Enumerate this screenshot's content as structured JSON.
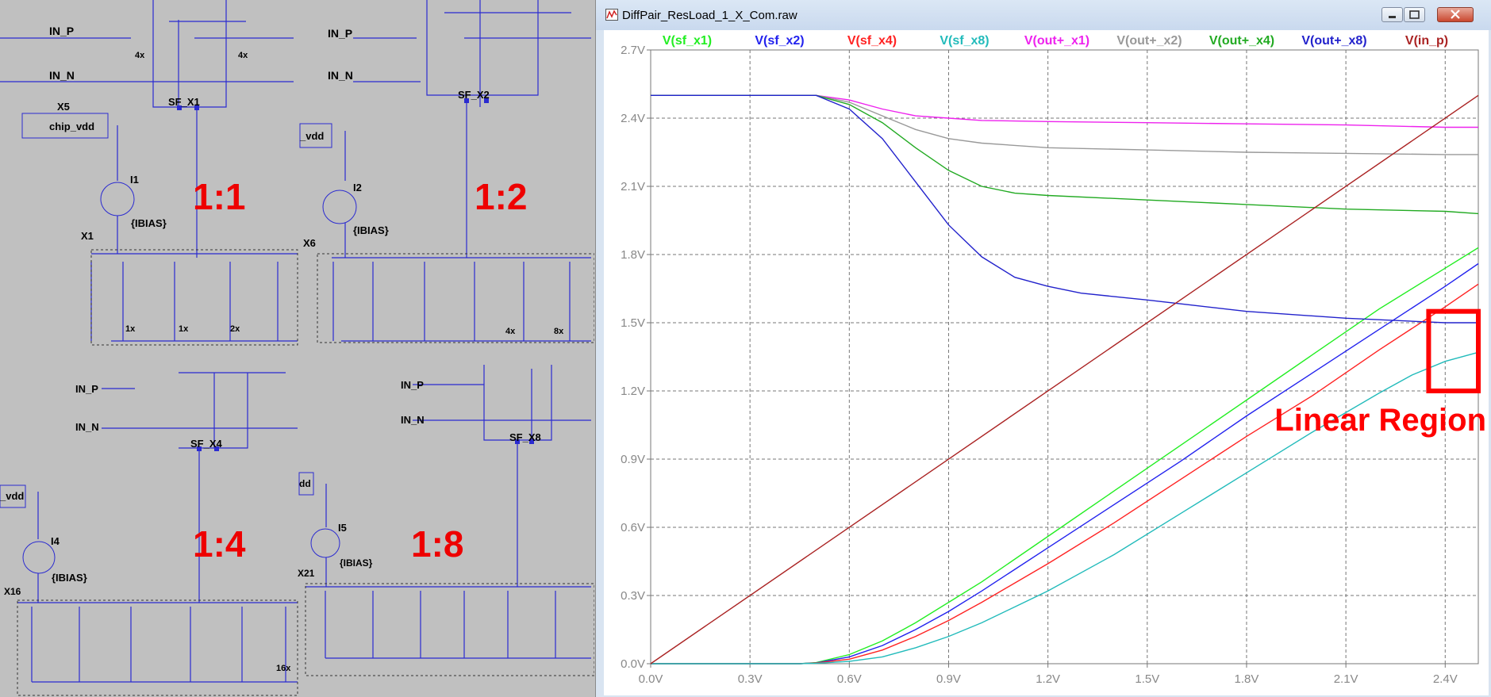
{
  "window": {
    "title": "DiffPair_ResLoad_1_X_Com.raw",
    "controls": {
      "minimize": "minimize",
      "maximize": "maximize",
      "close": "close"
    }
  },
  "schematic": {
    "net_labels": [
      "IN_P",
      "IN_N",
      "IN_P",
      "IN_N",
      "IN_P",
      "IN_N",
      "IN_P",
      "IN_N"
    ],
    "source_follower_labels": [
      "SF_X1",
      "SF_X2",
      "SF_X4",
      "SF_X8"
    ],
    "ratio_labels": [
      "1:1",
      "1:2",
      "1:4",
      "1:8"
    ],
    "current_sources": [
      "I1",
      "I2",
      "I4",
      "I5"
    ],
    "bias_label": "{IBIAS}",
    "instances": [
      "X5",
      "X1",
      "X6",
      "X16",
      "X21"
    ],
    "supply_label": "chip_vdd",
    "supply_partial": [
      "_vdd",
      "_vdd",
      "dd"
    ],
    "device_sizes": [
      "4x",
      "4x",
      "1x",
      "1x",
      "2x",
      "4x",
      "8x",
      "16x"
    ]
  },
  "chart_data": {
    "type": "line",
    "xlabel": "",
    "ylabel": "",
    "x_ticks": [
      "0.0V",
      "0.3V",
      "0.6V",
      "0.9V",
      "1.2V",
      "1.5V",
      "1.8V",
      "2.1V",
      "2.4V"
    ],
    "y_ticks": [
      "0.0V",
      "0.3V",
      "0.6V",
      "0.9V",
      "1.2V",
      "1.5V",
      "1.8V",
      "2.1V",
      "2.4V",
      "2.7V"
    ],
    "xlim": [
      0,
      2.5
    ],
    "ylim": [
      0,
      2.7
    ],
    "grid": true,
    "legend_placement": "top",
    "series": [
      {
        "name": "V(sf_x1)",
        "color": "#22ee22",
        "x": [
          0,
          0.45,
          0.5,
          0.6,
          0.7,
          0.8,
          0.9,
          1.0,
          1.2,
          1.4,
          1.6,
          1.8,
          2.0,
          2.2,
          2.4,
          2.5
        ],
        "y": [
          0,
          0,
          0.005,
          0.04,
          0.1,
          0.18,
          0.27,
          0.36,
          0.56,
          0.76,
          0.96,
          1.16,
          1.36,
          1.56,
          1.74,
          1.83
        ]
      },
      {
        "name": "V(sf_x2)",
        "color": "#2222ee",
        "x": [
          0,
          0.45,
          0.5,
          0.6,
          0.7,
          0.8,
          0.9,
          1.0,
          1.2,
          1.4,
          1.6,
          1.8,
          2.0,
          2.2,
          2.4,
          2.5
        ],
        "y": [
          0,
          0,
          0.004,
          0.03,
          0.08,
          0.15,
          0.23,
          0.32,
          0.51,
          0.7,
          0.89,
          1.09,
          1.28,
          1.47,
          1.66,
          1.76
        ]
      },
      {
        "name": "V(sf_x4)",
        "color": "#ff2222",
        "x": [
          0,
          0.45,
          0.5,
          0.6,
          0.7,
          0.8,
          0.9,
          1.0,
          1.2,
          1.4,
          1.6,
          1.8,
          2.0,
          2.2,
          2.4,
          2.5
        ],
        "y": [
          0,
          0,
          0.003,
          0.02,
          0.06,
          0.12,
          0.19,
          0.27,
          0.44,
          0.62,
          0.81,
          1.0,
          1.18,
          1.38,
          1.57,
          1.67
        ]
      },
      {
        "name": "V(sf_x8)",
        "color": "#22bbbb",
        "x": [
          0,
          0.45,
          0.5,
          0.6,
          0.7,
          0.8,
          0.9,
          1.0,
          1.2,
          1.4,
          1.6,
          1.8,
          2.0,
          2.2,
          2.3,
          2.4,
          2.5
        ],
        "y": [
          0,
          0,
          0.002,
          0.01,
          0.03,
          0.07,
          0.12,
          0.18,
          0.32,
          0.48,
          0.66,
          0.84,
          1.02,
          1.19,
          1.27,
          1.33,
          1.37
        ]
      },
      {
        "name": "V(out+_x1)",
        "color": "#ee22ee",
        "x": [
          0,
          0.45,
          0.5,
          0.6,
          0.7,
          0.8,
          0.9,
          1.0,
          1.2,
          1.5,
          1.8,
          2.1,
          2.4,
          2.5
        ],
        "y": [
          2.5,
          2.5,
          2.5,
          2.48,
          2.44,
          2.41,
          2.4,
          2.39,
          2.385,
          2.38,
          2.375,
          2.37,
          2.36,
          2.36
        ]
      },
      {
        "name": "V(out+_x2)",
        "color": "#999999",
        "x": [
          0,
          0.45,
          0.5,
          0.6,
          0.7,
          0.8,
          0.9,
          1.0,
          1.2,
          1.5,
          1.8,
          2.1,
          2.4,
          2.5
        ],
        "y": [
          2.5,
          2.5,
          2.5,
          2.47,
          2.41,
          2.35,
          2.31,
          2.29,
          2.27,
          2.26,
          2.25,
          2.245,
          2.24,
          2.24
        ]
      },
      {
        "name": "V(out+_x4)",
        "color": "#22aa22",
        "x": [
          0,
          0.45,
          0.5,
          0.6,
          0.7,
          0.8,
          0.9,
          1.0,
          1.1,
          1.2,
          1.5,
          1.8,
          2.1,
          2.4,
          2.5
        ],
        "y": [
          2.5,
          2.5,
          2.5,
          2.46,
          2.38,
          2.27,
          2.17,
          2.1,
          2.07,
          2.06,
          2.04,
          2.02,
          2.0,
          1.99,
          1.98
        ]
      },
      {
        "name": "V(out+_x8)",
        "color": "#2222cc",
        "x": [
          0,
          0.45,
          0.5,
          0.6,
          0.7,
          0.8,
          0.9,
          1.0,
          1.1,
          1.2,
          1.3,
          1.5,
          1.8,
          2.1,
          2.4,
          2.5
        ],
        "y": [
          2.5,
          2.5,
          2.5,
          2.44,
          2.31,
          2.12,
          1.93,
          1.79,
          1.7,
          1.66,
          1.63,
          1.6,
          1.55,
          1.52,
          1.5,
          1.5
        ]
      },
      {
        "name": "V(in_p)",
        "color": "#aa2222",
        "x": [
          0,
          2.5
        ],
        "y": [
          0,
          2.5
        ]
      }
    ],
    "annotation": {
      "text": "Linear Region",
      "color": "#ff0000",
      "box_x": [
        2.35,
        2.5
      ],
      "box_y": [
        1.2,
        1.55
      ]
    }
  }
}
